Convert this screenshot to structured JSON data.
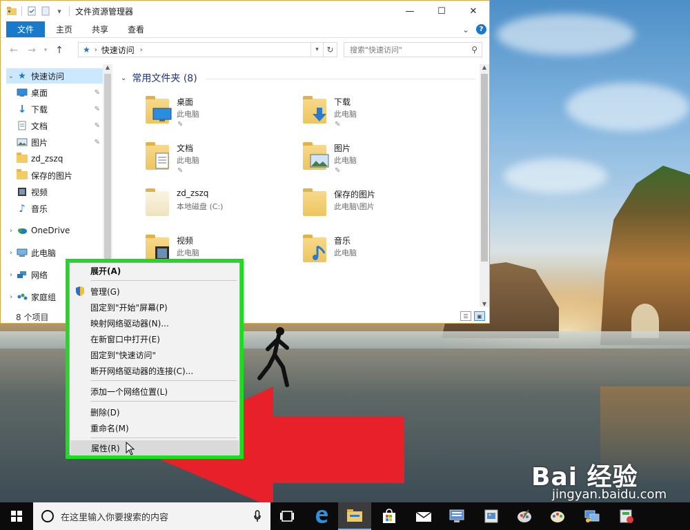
{
  "window": {
    "title": "文件资源管理器",
    "controls": {
      "minimize": "—",
      "maximize": "☐",
      "close": "✕"
    }
  },
  "ribbon": {
    "tabs": [
      "文件",
      "主页",
      "共享",
      "查看"
    ],
    "collapse": "⌄",
    "help": "?"
  },
  "address": {
    "crumb": "快速访问",
    "search_placeholder": "搜索\"快速访问\""
  },
  "nav_pane": {
    "items": [
      {
        "label": "快速访问"
      },
      {
        "label": "桌面"
      },
      {
        "label": "下载"
      },
      {
        "label": "文档"
      },
      {
        "label": "图片"
      },
      {
        "label": "zd_zszq"
      },
      {
        "label": "保存的图片"
      },
      {
        "label": "视频"
      },
      {
        "label": "音乐"
      },
      {
        "label": "OneDrive"
      },
      {
        "label": "此电脑"
      },
      {
        "label": "网络"
      },
      {
        "label": "家庭组"
      }
    ]
  },
  "content": {
    "group_title": "常用文件夹 (8)",
    "tiles": [
      {
        "name": "桌面",
        "sub": "此电脑"
      },
      {
        "name": "下载",
        "sub": "此电脑"
      },
      {
        "name": "文档",
        "sub": "此电脑"
      },
      {
        "name": "图片",
        "sub": "此电脑"
      },
      {
        "name": "zd_zszq",
        "sub": "本地磁盘 (C:)"
      },
      {
        "name": "保存的图片",
        "sub": "此电脑\\图片"
      },
      {
        "name": "视频",
        "sub": "此电脑"
      },
      {
        "name": "音乐",
        "sub": "此电脑"
      }
    ]
  },
  "status": {
    "count": "8 个项目"
  },
  "context_menu": {
    "items": [
      {
        "label": "展开(A)"
      },
      {
        "label": "管理(G)"
      },
      {
        "label": "固定到\"开始\"屏幕(P)"
      },
      {
        "label": "映射网络驱动器(N)..."
      },
      {
        "label": "在新窗口中打开(E)"
      },
      {
        "label": "固定到\"快速访问\""
      },
      {
        "label": "断开网络驱动器的连接(C)..."
      },
      {
        "label": "添加一个网络位置(L)"
      },
      {
        "label": "删除(D)"
      },
      {
        "label": "重命名(M)"
      },
      {
        "label": "属性(R)"
      }
    ]
  },
  "taskbar": {
    "search_placeholder": "在这里输入你要搜索的内容"
  },
  "watermark": {
    "main": "Bai 经验",
    "sub": "jingyan.baidu.com"
  },
  "colors": {
    "accent": "#1979ca",
    "highlight_box": "#19e01d",
    "arrow": "#e8202a",
    "selection": "#cce8ff"
  }
}
